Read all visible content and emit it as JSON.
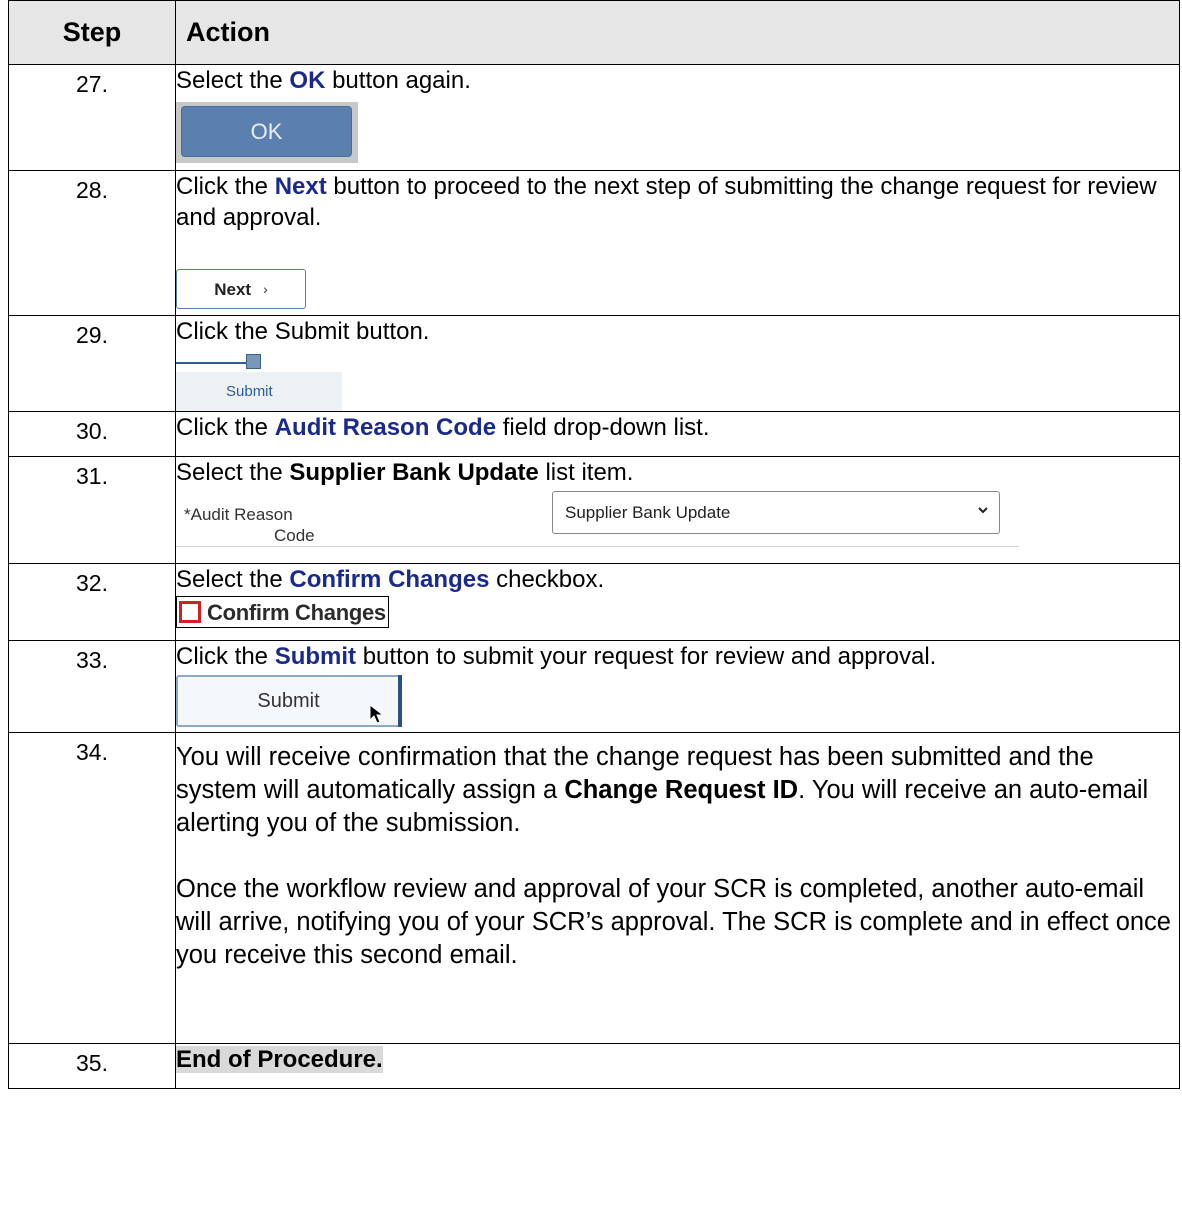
{
  "header": {
    "step": "Step",
    "action": "Action"
  },
  "rows": [
    {
      "num": "27.",
      "pre": "Select the ",
      "kw": "OK",
      "post": " button again.",
      "button": "OK"
    },
    {
      "num": "28.",
      "pre": "Click the ",
      "kw": "Next",
      "post": " button to proceed to the next step of submitting the change request for review and approval.",
      "button": "Next",
      "icon": "chevron-right-icon"
    },
    {
      "num": "29.",
      "text": "Click the Submit button.",
      "button": "Submit"
    },
    {
      "num": "30.",
      "pre": "Click the ",
      "kw": "Audit Reason Code",
      "post": " field drop-down list."
    },
    {
      "num": "31.",
      "pre": "Select the ",
      "kb": "Supplier Bank Update",
      "post": " list item.",
      "field_label_1": "*Audit Reason",
      "field_label_2": "Code",
      "field_value": "Supplier Bank Update"
    },
    {
      "num": "32.",
      "pre": "Select the ",
      "kw": "Confirm Changes",
      "post": " checkbox.",
      "checkbox_label": "Confirm Changes"
    },
    {
      "num": "33.",
      "pre": "Click the ",
      "kw": "Submit",
      "post": " button to submit your request for review and approval.",
      "button": "Submit"
    },
    {
      "num": "34.",
      "p1_pre": "You will receive confirmation that the change request has been submitted and the system will automatically assign a ",
      "p1_bold": "Change Request ID",
      "p1_post": ".  You will receive an auto-email alerting you of the submission.",
      "p2": "Once the workflow review and approval of your SCR is completed, another auto-email will arrive, notifying you of your SCR’s approval. The SCR is complete and in effect once you receive this second email."
    },
    {
      "num": "35.",
      "text": "End of Procedure."
    }
  ]
}
